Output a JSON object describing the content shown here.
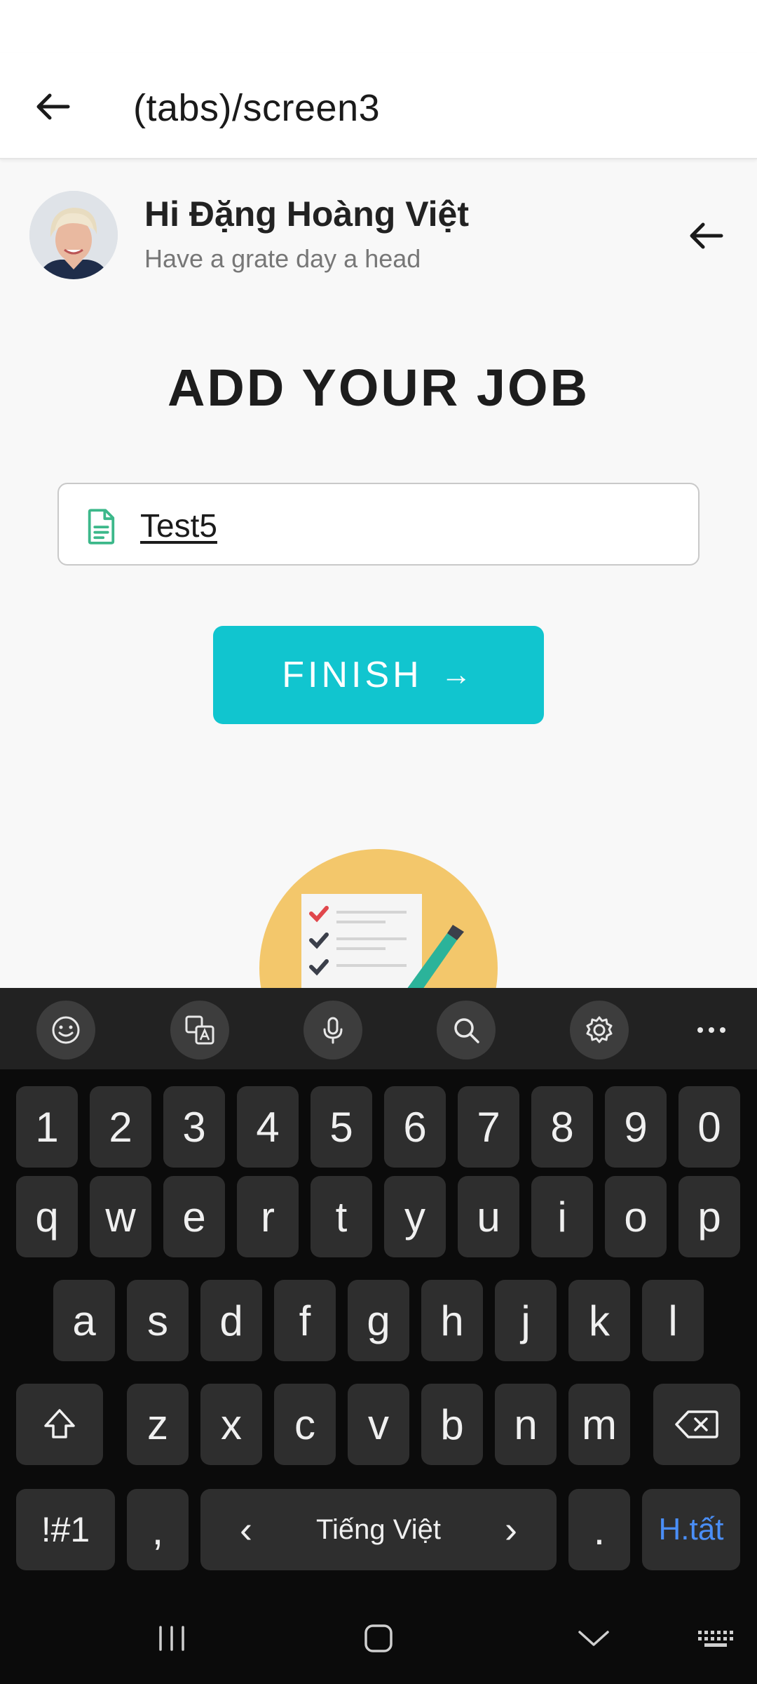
{
  "header": {
    "title": "(tabs)/screen3"
  },
  "profile": {
    "greeting": "Hi Đặng Hoàng Việt",
    "subtitle": "Have a grate day a head"
  },
  "main": {
    "heading": "ADD YOUR JOB",
    "job_input": {
      "value": "Test5",
      "icon": "document-icon"
    },
    "finish_label": "FINISH",
    "finish_arrow": "→"
  },
  "keyboard": {
    "toolbar": [
      "emoji-icon",
      "translate-icon",
      "microphone-icon",
      "search-icon",
      "settings-icon",
      "more-icon"
    ],
    "row_numbers": [
      "1",
      "2",
      "3",
      "4",
      "5",
      "6",
      "7",
      "8",
      "9",
      "0"
    ],
    "row_top": [
      "q",
      "w",
      "e",
      "r",
      "t",
      "y",
      "u",
      "i",
      "o",
      "p"
    ],
    "row_mid": [
      "a",
      "s",
      "d",
      "f",
      "g",
      "h",
      "j",
      "k",
      "l"
    ],
    "row_bottom": [
      "z",
      "x",
      "c",
      "v",
      "b",
      "n",
      "m"
    ],
    "symbols_label": "!#1",
    "comma": ",",
    "space_label": "Tiếng Việt",
    "space_left": "‹",
    "space_right": "›",
    "period": ".",
    "done_label": "H.tất"
  },
  "colors": {
    "accent": "#11c5cf",
    "done_blue": "#4a8ef7",
    "doc_icon_green": "#3cb88a",
    "illustration_circle": "#f3c76b"
  }
}
